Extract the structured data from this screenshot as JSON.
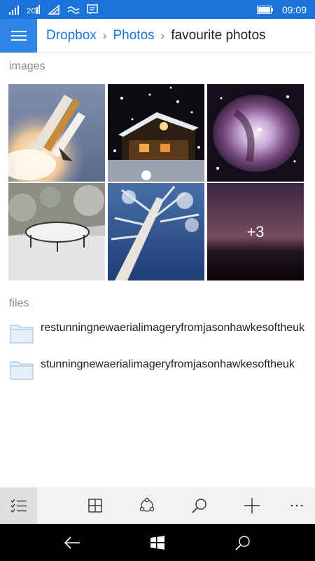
{
  "status": {
    "time": "09:09"
  },
  "header": {
    "breadcrumb": [
      {
        "label": "Dropbox"
      },
      {
        "label": "Photos"
      }
    ],
    "current": "favourite photos"
  },
  "images_section": {
    "label": "images",
    "more_count": "+3",
    "tiles": [
      "shuttle launch",
      "snowy house at night",
      "orion nebula",
      "snow trampoline",
      "frosted tree",
      "pink sunset"
    ]
  },
  "files_section": {
    "label": "files",
    "items": [
      {
        "name": "restunningnewaerialimageryfromjasonhawkesoftheuk"
      },
      {
        "name": "stunningnewaerialimageryfromjasonhawkesoftheuk"
      }
    ]
  },
  "colors": {
    "accent": "#1a73d9",
    "menu_bg": "#2f86e8"
  }
}
